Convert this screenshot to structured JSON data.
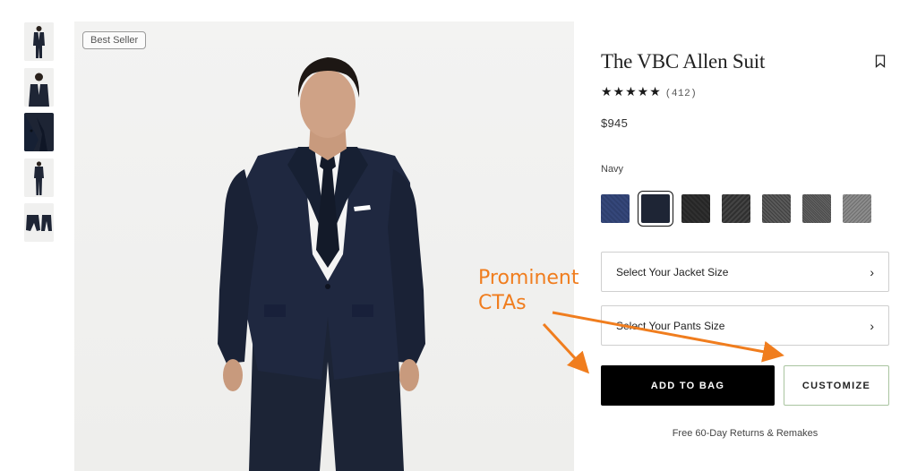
{
  "thumbnails": [
    {
      "name": "thumb-front-full"
    },
    {
      "name": "thumb-front-upper"
    },
    {
      "name": "thumb-fabric-detail"
    },
    {
      "name": "thumb-full-length"
    },
    {
      "name": "thumb-flat-lay"
    }
  ],
  "hero": {
    "badge": "Best Seller"
  },
  "product": {
    "title": "The VBC Allen Suit",
    "stars": "★★★★★",
    "rating_count": "(412)",
    "price": "$945",
    "color_label": "Navy"
  },
  "swatches": [
    {
      "color": "#2e3f6e",
      "selected": false
    },
    {
      "color": "#1e2535",
      "selected": true
    },
    {
      "color": "#2b2b2b",
      "selected": false
    },
    {
      "color": "#3a3a3a",
      "selected": false
    },
    {
      "color": "#4c4c4c",
      "selected": false
    },
    {
      "color": "#565656",
      "selected": false
    },
    {
      "color": "#7a7a7a",
      "selected": false
    }
  ],
  "sizes": {
    "jacket_label": "Select Your Jacket Size",
    "pants_label": "Select Your Pants Size",
    "chevron": "›"
  },
  "actions": {
    "add_to_bag": "ADD TO BAG",
    "customize": "CUSTOMIZE"
  },
  "returns_note": "Free 60-Day Returns & Remakes",
  "annotation": {
    "line1": "Prominent",
    "line2": "CTAs",
    "color": "#f07d1e"
  }
}
